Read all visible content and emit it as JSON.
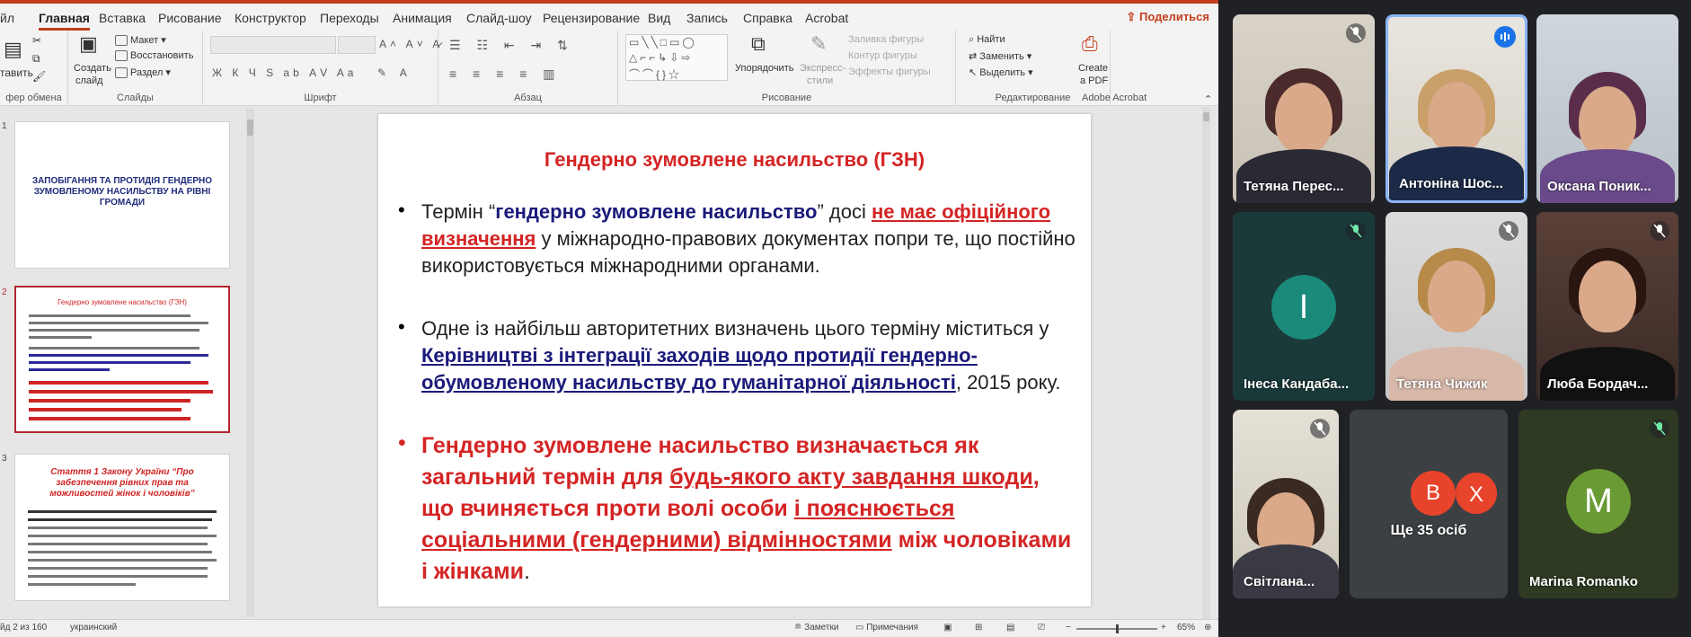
{
  "ribbon": {
    "tabs": [
      "йл",
      "Главная",
      "Вставка",
      "Рисование",
      "Конструктор",
      "Переходы",
      "Анимация",
      "Слайд-шоу",
      "Рецензирование",
      "Вид",
      "Запись",
      "Справка",
      "Acrobat"
    ],
    "active_tab": "Главная",
    "share_label": "Поделиться",
    "share_icon": "share-icon",
    "groups": {
      "clipboard": {
        "label": "фер обмена",
        "paste_label": "тавить"
      },
      "slides": {
        "label": "Слайды",
        "new_slide_line1": "Создать",
        "new_slide_line2": "слайд",
        "layout": "Макет",
        "reset": "Восстановить",
        "section": "Раздел"
      },
      "font": {
        "label": "Шрифт",
        "buttons": "Ж К Ч S ab АV Aa"
      },
      "paragraph": {
        "label": "Абзац"
      },
      "drawing": {
        "label": "Рисование",
        "arrange": "Упорядочить",
        "quick_styles_line1": "Экспресс-",
        "quick_styles_line2": "стили",
        "fill": "Заливка фигуры",
        "outline": "Контур фигуры",
        "effects": "Эффекты фигуры"
      },
      "editing": {
        "label": "Редактирование",
        "find": "Найти",
        "replace": "Заменить",
        "select": "Выделить"
      },
      "acrobat": {
        "label": "Adobe Acrobat",
        "create_line1": "Create",
        "create_line2": "a PDF"
      }
    }
  },
  "thumbnails": {
    "slide1": {
      "number": "1",
      "title": "ЗАПОБІГАННЯ ТА ПРОТИДІЯ ГЕНДЕРНО ЗУМОВЛЕНОМУ НАСИЛЬСТВУ НА РІВНІ ГРОМАДИ"
    },
    "slide2": {
      "number": "2",
      "title": "Гендерно зумовлене насильство (ГЗН)"
    },
    "slide3": {
      "number": "3",
      "title": "Стаття 1 Закону України “Про забезпечення рівних прав та можливостей жінок і чоловіків”"
    }
  },
  "slide": {
    "title": "Гендерно зумовлене насильство (ГЗН)",
    "bullet1": {
      "t1": "Термін “",
      "t2": "гендерно зумовлене насильство",
      "t3": "” досі ",
      "t4": "не має офіційного визначення",
      "t5": " у міжнародно-правових документах попри те, що постійно використовується міжнародними органами."
    },
    "bullet2": {
      "t1": "Одне із найбільш авторитетних визначень цього терміну міститься у ",
      "t2": "Керівництві з інтеграції заходів щодо протидії гендерно-обумовленому насильству до гуманітарної діяльності",
      "t3": ", 2015 року."
    },
    "bullet3": {
      "t1": "Гендерно зумовлене насильство визначається як загальний термін для ",
      "t2": "будь-якого акту завдання шкоди",
      "t3": ", що вчиняється проти волі особи ",
      "t4": "і пояснюється соціальними (гендерними) відмінностями",
      "t5": " між чоловіками і жінками",
      "t6": "."
    }
  },
  "statusbar": {
    "slide_counter": "йд 2 из 160",
    "language": "украинский",
    "notes": "Заметки",
    "comments": "Примечания",
    "zoom": "65%",
    "zoom_level": 0.5
  },
  "participants": [
    {
      "name": "Тетяна Перес...",
      "muted": true,
      "type": "video"
    },
    {
      "name": "Антоніна Шос...",
      "muted": false,
      "speaking": true,
      "type": "video"
    },
    {
      "name": "Оксана Поник...",
      "muted": false,
      "type": "video"
    },
    {
      "name": "Інеса Кандаба...",
      "muted": true,
      "type": "avatar",
      "initial": "I",
      "color": "#1a8a7a"
    },
    {
      "name": "Тетяна Чижик",
      "muted": true,
      "type": "video"
    },
    {
      "name": "Люба Бордач...",
      "muted": true,
      "type": "video"
    },
    {
      "name": "Світлана...",
      "muted": true,
      "type": "video"
    },
    {
      "name": "Ще 35 осіб",
      "type": "overflow",
      "initials": [
        "В",
        "Х"
      ],
      "colors": [
        "#e8432b",
        "#e8432b"
      ]
    },
    {
      "name": "Marina Romanko",
      "muted": true,
      "type": "avatar",
      "initial": "M",
      "color": "#6a9a34"
    }
  ],
  "colors": {
    "accent": "#c43e1c",
    "slide_red": "#d42424",
    "slide_blue": "#1a1a7a",
    "speaking": "#8ab4f8"
  }
}
